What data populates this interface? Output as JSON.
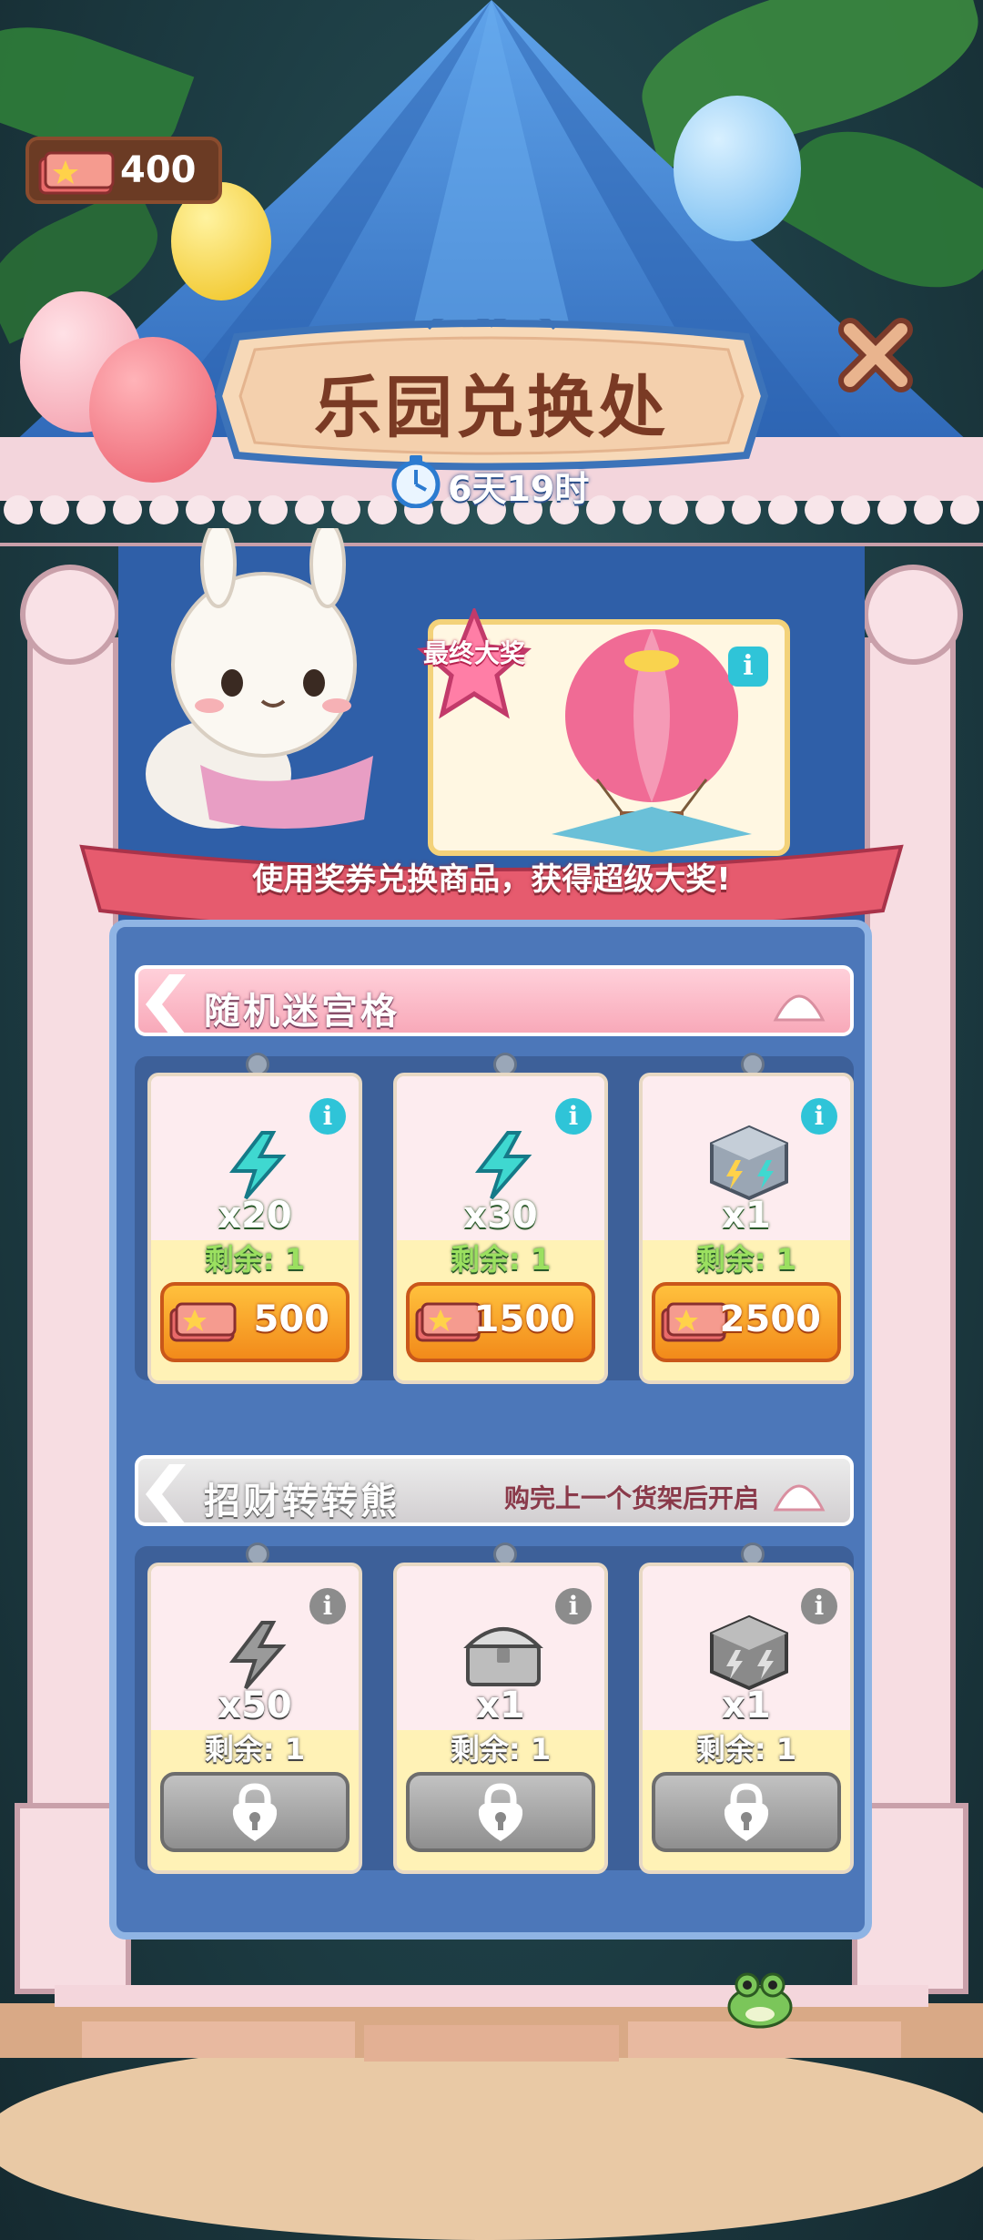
{
  "header": {
    "ticket_count": "400",
    "title": "乐园兑换处",
    "timer": "6天19时"
  },
  "grand_prize": {
    "badge": "最终大奖",
    "banner": "使用奖券兑换商品，获得超级大奖!"
  },
  "sections": [
    {
      "title": "随机迷宫格",
      "subtitle": "",
      "locked": false,
      "items": [
        {
          "icon": "lightning-icon",
          "qty": "x20",
          "remain": "剩余: 1",
          "price": "500"
        },
        {
          "icon": "lightning-icon",
          "qty": "x30",
          "remain": "剩余: 1",
          "price": "1500"
        },
        {
          "icon": "lightning-box-icon",
          "qty": "x1",
          "remain": "剩余: 1",
          "price": "2500"
        }
      ]
    },
    {
      "title": "招财转转熊",
      "subtitle": "购完上一个货架后开启",
      "locked": true,
      "items": [
        {
          "icon": "lightning-icon",
          "qty": "x50",
          "remain": "剩余: 1"
        },
        {
          "icon": "chest-icon",
          "qty": "x1",
          "remain": "剩余: 1"
        },
        {
          "icon": "lightning-box-icon",
          "qty": "x1",
          "remain": "剩余: 1"
        }
      ]
    }
  ],
  "colors": {
    "roof": "#3f7fd0",
    "panel": "#4c77b9",
    "pink_header": "#f8a9b9",
    "grey_header": "#d9d6d8",
    "orange_button": "#f5a02a",
    "info_active": "#2fc4d8",
    "info_locked": "#8c8c8c"
  }
}
